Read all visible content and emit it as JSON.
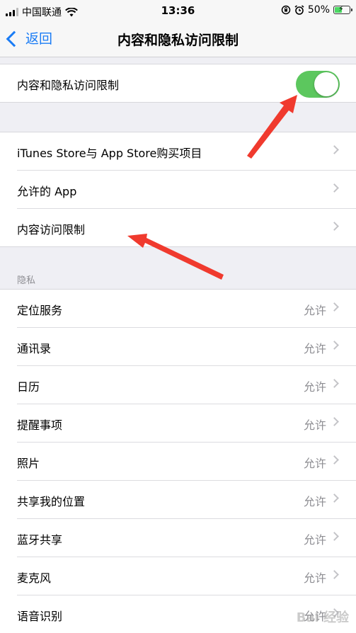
{
  "status_bar": {
    "carrier": "中国联通",
    "time": "13:36",
    "battery_percent": "50%",
    "battery_level": 0.5,
    "icons": [
      "signal-icon",
      "wifi-icon",
      "rotation-lock-icon",
      "alarm-icon",
      "battery-charging-icon"
    ]
  },
  "nav": {
    "back_label": "返回",
    "title": "内容和隐私访问限制"
  },
  "main_toggle": {
    "label": "内容和隐私访问限制",
    "on": true,
    "color": "#5cc75e"
  },
  "store_group": [
    {
      "label": "iTunes Store与 App Store购买项目"
    },
    {
      "label": "允许的 App"
    },
    {
      "label": "内容访问限制"
    }
  ],
  "privacy": {
    "header": "隐私",
    "items": [
      {
        "label": "定位服务",
        "value": "允许"
      },
      {
        "label": "通讯录",
        "value": "允许"
      },
      {
        "label": "日历",
        "value": "允许"
      },
      {
        "label": "提醒事项",
        "value": "允许"
      },
      {
        "label": "照片",
        "value": "允许"
      },
      {
        "label": "共享我的位置",
        "value": "允许"
      },
      {
        "label": "蓝牙共享",
        "value": "允许"
      },
      {
        "label": "麦克风",
        "value": "允许"
      },
      {
        "label": "语音识别",
        "value": "允许"
      }
    ]
  },
  "watermark": "Bai 经验",
  "colors": {
    "accent": "#1a7cf5",
    "annotation_arrow": "#f03a2e"
  }
}
